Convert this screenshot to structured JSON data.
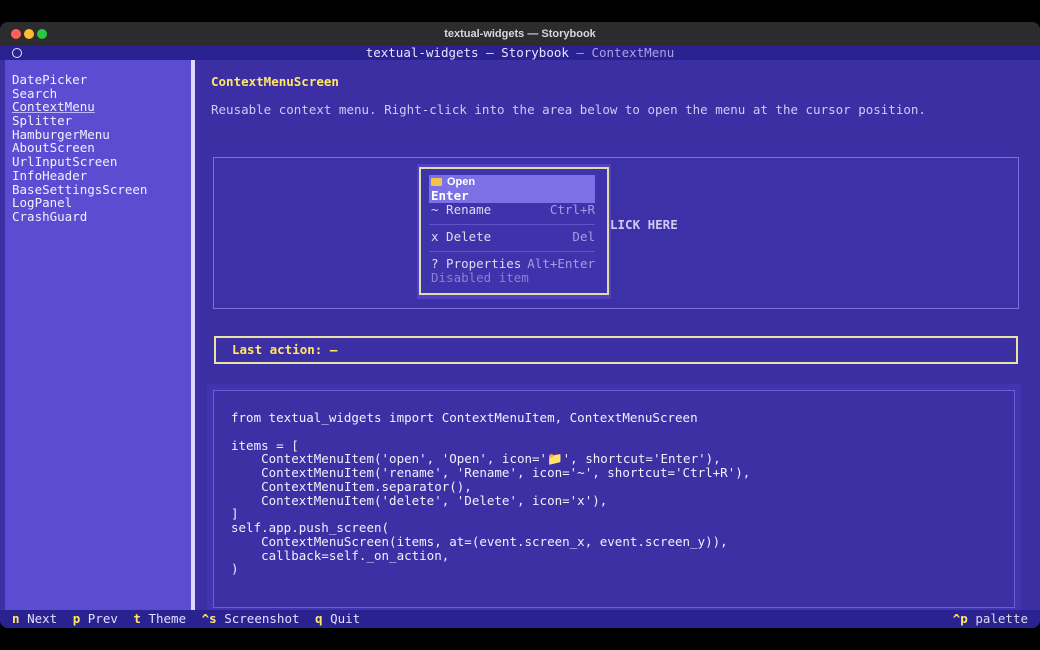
{
  "window": {
    "title": "textual-widgets — Storybook"
  },
  "header": {
    "title": "textual-widgets — Storybook",
    "separator": " — ",
    "subtitle": "ContextMenu"
  },
  "sidebar": {
    "items": [
      {
        "label": "DatePicker"
      },
      {
        "label": "Search"
      },
      {
        "label": "ContextMenu",
        "active": true
      },
      {
        "label": "Splitter"
      },
      {
        "label": "HamburgerMenu"
      },
      {
        "label": "AboutScreen"
      },
      {
        "label": "UrlInputScreen"
      },
      {
        "label": "InfoHeader"
      },
      {
        "label": "BaseSettingsScreen"
      },
      {
        "label": "LogPanel"
      },
      {
        "label": "CrashGuard"
      }
    ]
  },
  "main": {
    "title": "ContextMenuScreen",
    "description": "Reusable context menu. Right-click into the area below to open the menu at the cursor position.",
    "click_area_label": "LICK HERE",
    "last_action": "Last action: —",
    "code_lines": [
      "from textual_widgets import ContextMenuItem, ContextMenuScreen",
      "",
      "items = [",
      "    ContextMenuItem('open', 'Open', icon='📁', shortcut='Enter'),",
      "    ContextMenuItem('rename', 'Rename', icon='~', shortcut='Ctrl+R'),",
      "    ContextMenuItem.separator(),",
      "    ContextMenuItem('delete', 'Delete', icon='x'),",
      "]",
      "self.app.push_screen(",
      "    ContextMenuScreen(items, at=(event.screen_x, event.screen_y)),",
      "    callback=self._on_action,",
      ")"
    ]
  },
  "menu": {
    "open": {
      "label": "Open",
      "shortcut": "Enter",
      "icon": "folder-icon"
    },
    "rename": {
      "label": "~ Rename",
      "shortcut": "Ctrl+R"
    },
    "delete": {
      "label": "x Delete",
      "shortcut": "Del"
    },
    "properties": {
      "label": "? Properties",
      "shortcut": "Alt+Enter"
    },
    "disabled": {
      "label": "Disabled item"
    }
  },
  "footer": {
    "left": [
      {
        "key": "n",
        "label": "Next"
      },
      {
        "key": "p",
        "label": "Prev"
      },
      {
        "key": "t",
        "label": "Theme"
      },
      {
        "key": "^s",
        "label": "Screenshot"
      },
      {
        "key": "q",
        "label": "Quit"
      }
    ],
    "right": {
      "key": "^p",
      "label": "palette"
    }
  },
  "colors": {
    "background": "#3b2fa3",
    "sidebar": "#5b4cd1",
    "accent": "#ffe866",
    "highlight": "#7c70e6"
  }
}
